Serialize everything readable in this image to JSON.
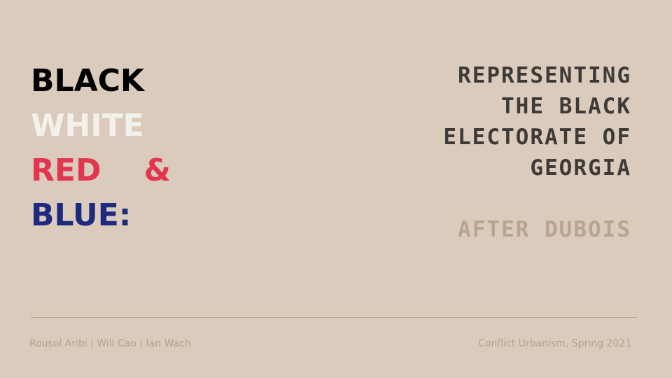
{
  "title": {
    "line1": "BLACK",
    "line2": "WHITE",
    "line3_word1": "RED",
    "line3_word2": "&",
    "line4": "BLUE:"
  },
  "subtitle": {
    "lines": [
      "REPRESENTING",
      "THE BLACK",
      "ELECTORATE OF",
      "GEORGIA"
    ],
    "after": "AFTER DUBOIS"
  },
  "footer": {
    "authors": "Rousol Aribi | Will Cao | Ian Wach",
    "course": "Conflict Urbanism, Spring 2021"
  },
  "colors": {
    "background": "#dbcbbd",
    "black": "#000000",
    "white": "#f4f1ec",
    "red": "#e2364f",
    "blue": "#1e2a80",
    "subtitle": "#3d3a37",
    "accent": "#b9a391"
  }
}
